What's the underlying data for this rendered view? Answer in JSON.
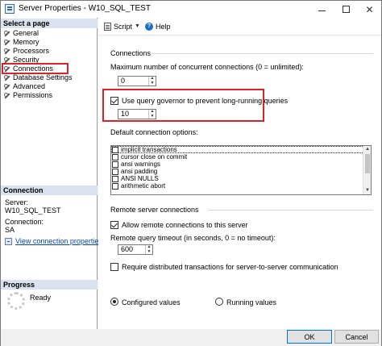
{
  "window": {
    "title": "Server Properties - W10_SQL_TEST"
  },
  "left": {
    "select_page_header": "Select a page",
    "pages": [
      "General",
      "Memory",
      "Processors",
      "Security",
      "Connections",
      "Database Settings",
      "Advanced",
      "Permissions"
    ],
    "selected_page": "Connections",
    "connection_header": "Connection",
    "server_label": "Server:",
    "server_value": "W10_SQL_TEST",
    "connection_label": "Connection:",
    "connection_value": "SA",
    "view_link": "View connection properties",
    "progress_header": "Progress",
    "progress_status": "Ready"
  },
  "toolbar": {
    "script_label": "Script",
    "help_label": "Help"
  },
  "connections": {
    "group_title": "Connections",
    "max_connections_label": "Maximum number of concurrent connections (0 = unlimited):",
    "max_connections_value": "0",
    "query_governor_label": "Use query governor to prevent long-running queries",
    "query_governor_checked": true,
    "query_governor_value": "10",
    "default_options_label": "Default connection options:",
    "default_options": [
      {
        "label": "implicit transactions",
        "checked": false
      },
      {
        "label": "cursor close on commit",
        "checked": false
      },
      {
        "label": "ansi warnings",
        "checked": false
      },
      {
        "label": "ansi padding",
        "checked": false
      },
      {
        "label": "ANSI NULLS",
        "checked": false
      },
      {
        "label": "arithmetic abort",
        "checked": false
      }
    ]
  },
  "remote": {
    "group_title": "Remote server connections",
    "allow_remote_label": "Allow remote connections to this server",
    "allow_remote_checked": true,
    "timeout_label": "Remote query timeout (in seconds, 0 = no timeout):",
    "timeout_value": "600",
    "distributed_label": "Require distributed transactions for server-to-server communication",
    "distributed_checked": false
  },
  "values_mode": {
    "configured_label": "Configured values",
    "running_label": "Running values",
    "selected": "configured"
  },
  "buttons": {
    "ok": "OK",
    "cancel": "Cancel"
  },
  "colors": {
    "highlight_red": "#d8232a",
    "section_header_bg": "#d9e2ee",
    "link_blue": "#0645ad"
  }
}
